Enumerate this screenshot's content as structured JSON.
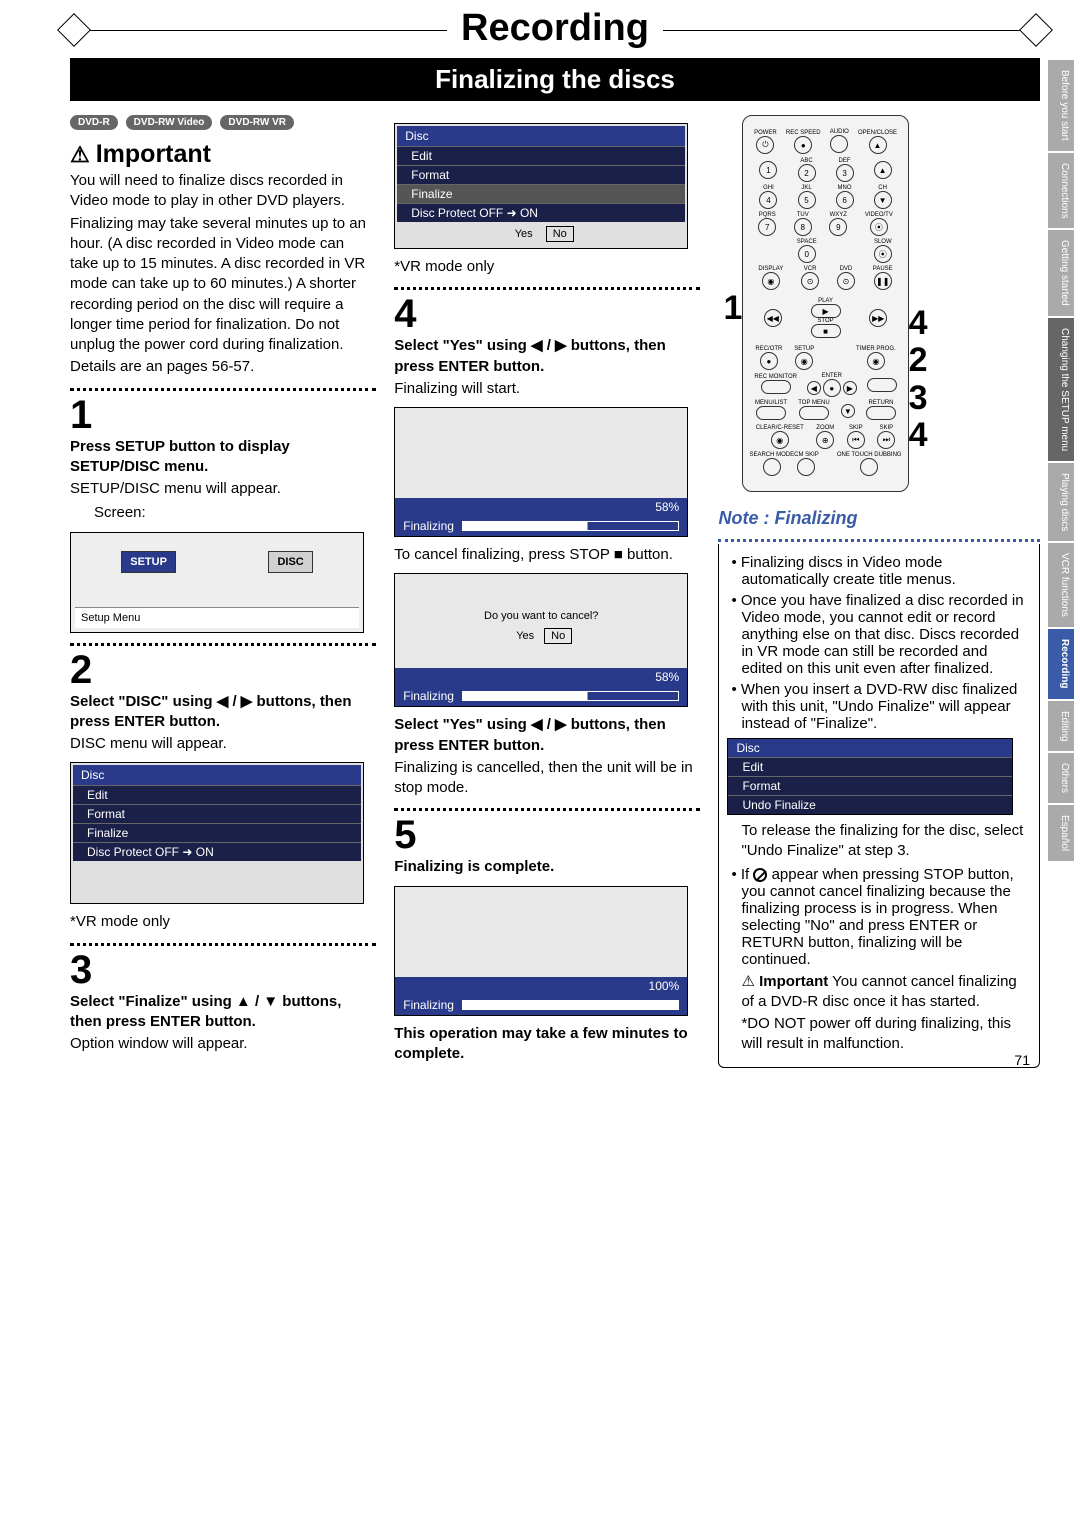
{
  "page": {
    "title": "Recording",
    "subtitle": "Finalizing the discs",
    "number": "71"
  },
  "badges": [
    "DVD-R",
    "DVD-RW Video",
    "DVD-RW VR"
  ],
  "important": {
    "heading": "Important",
    "body1": "You will need to finalize discs recorded in Video mode to play in other DVD players.",
    "body2": "Finalizing may take several minutes up to an hour. (A disc recorded in Video mode can take up to 15 minutes. A disc recorded in VR mode can take up to 60 minutes.) A shorter recording period on the disc will require a longer time period for finalization. Do not unplug the power cord during finalization.",
    "body3": "Details are an pages 56-57."
  },
  "step1": {
    "num": "1",
    "bold": "Press SETUP button to display SETUP/DISC menu.",
    "text": "SETUP/DISC menu will appear.",
    "screenLabel": "Screen:",
    "menuSetup": "SETUP",
    "menuDisc": "DISC",
    "menuCaption": "Setup Menu"
  },
  "step2": {
    "num": "2",
    "bold": "Select \"DISC\" using ◀ / ▶ buttons, then press ENTER button.",
    "text": "DISC menu will appear.",
    "menu": {
      "header": "Disc",
      "items": [
        "Edit",
        "Format",
        "Finalize",
        "Disc Protect OFF ➜ ON"
      ]
    },
    "footnote": "*VR mode only"
  },
  "step3": {
    "num": "3",
    "bold": "Select \"Finalize\" using ▲ / ▼ buttons, then press ENTER button.",
    "text": "Option window will appear.",
    "menu": {
      "header": "Disc",
      "items": [
        "Edit",
        "Format",
        "Finalize",
        "Disc Protect OFF ➜ ON"
      ]
    },
    "yes": "Yes",
    "no": "No",
    "footnote": "*VR mode only"
  },
  "step4": {
    "num": "4",
    "bold": "Select \"Yes\" using ◀ / ▶ buttons, then press ENTER button.",
    "textA": "Finalizing will start.",
    "pct": "58%",
    "label": "Finalizing",
    "textB": "To cancel finalizing, press STOP ■ button.",
    "cancelQ": "Do you want to cancel?",
    "yes": "Yes",
    "no": "No",
    "bold2": "Select \"Yes\" using ◀ / ▶ buttons, then press ENTER button.",
    "textC": "Finalizing is cancelled, then the unit will be in stop mode."
  },
  "step5": {
    "num": "5",
    "bold": "Finalizing is complete.",
    "pct": "100%",
    "label": "Finalizing",
    "warn": "This operation may take a few minutes to complete."
  },
  "remoteCallouts": {
    "left1": "1",
    "r1": "4",
    "r2": "2",
    "r3": "3",
    "r4": "4"
  },
  "remote": {
    "row1": [
      "POWER",
      "REC SPEED",
      "AUDIO",
      "OPEN/CLOSE"
    ],
    "numLabels": [
      "",
      "ABC",
      "DEF",
      "",
      "GHI",
      "JKL",
      "MNO",
      "CH",
      "PQRS",
      "TUV",
      "WXYZ",
      "VIDEO/TV",
      "",
      "SPACE",
      "",
      "SLOW"
    ],
    "nums": [
      "1",
      "2",
      "3",
      "▲",
      "4",
      "5",
      "6",
      "▼",
      "7",
      "8",
      "9",
      "",
      "",
      "0",
      "",
      ""
    ],
    "rowD": [
      "DISPLAY",
      "VCR",
      "DVD",
      "PAUSE"
    ],
    "play": "PLAY",
    "stop": "STOP",
    "rowR": [
      "REC/OTR",
      "SETUP",
      "",
      "TIMER PROG."
    ],
    "enter": "ENTER",
    "recmon": "REC MONITOR",
    "rowM": [
      "MENU/LIST",
      "TOP MENU",
      "",
      "RETURN"
    ],
    "rowZ": [
      "CLEAR/C-RESET",
      "ZOOM",
      "SKIP",
      "SKIP"
    ],
    "rowB": [
      "SEARCH MODE",
      "CM SKIP",
      "",
      "ONE TOUCH DUBBING"
    ]
  },
  "note": {
    "heading": "Note : Finalizing",
    "li1": "Finalizing discs in Video mode automatically create title menus.",
    "li2": "Once you have finalized a disc recorded in Video mode, you cannot edit or record anything else on that disc. Discs recorded in VR mode can still be recorded and edited on this unit even after finalized.",
    "li3": "When you insert a DVD-RW disc finalized with this unit, \"Undo Finalize\" will appear instead of \"Finalize\".",
    "menu": {
      "header": "Disc",
      "items": [
        "Edit",
        "Format",
        "Undo Finalize"
      ]
    },
    "li3b": "To release the finalizing for the disc, select \"Undo Finalize\" at step 3.",
    "li4a": "If ",
    "li4b": " appear when pressing STOP button, you cannot cancel finalizing because the finalizing process is in progress. When selecting \"No\" and press ENTER or RETURN button, finalizing will be continued.",
    "imp": "Important",
    "impText": "You cannot cancel finalizing of a DVD-R disc once it has started.",
    "star": "*DO NOT power off during finalizing, this will result in malfunction."
  },
  "tabs": [
    "Before you start",
    "Connections",
    "Getting started",
    "Changing the SETUP menu",
    "Playing discs",
    "VCR functions",
    "Recording",
    "Editing",
    "Others",
    "Español"
  ]
}
